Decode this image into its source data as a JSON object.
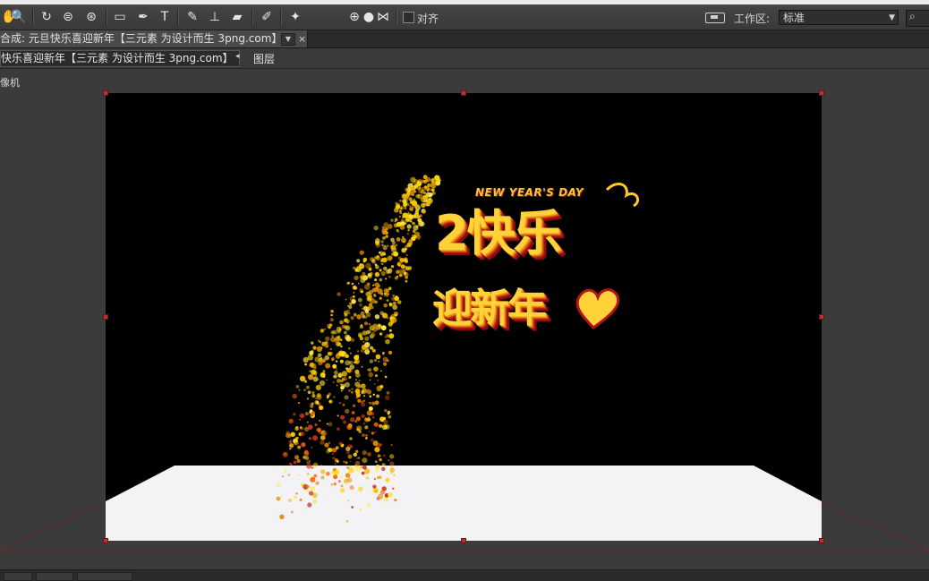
{
  "toolbar": {
    "tools": [
      {
        "icon": "hand-icon",
        "glyph": "✋"
      },
      {
        "icon": "zoom-icon",
        "glyph": "🔍"
      },
      {
        "icon": "rotate-icon",
        "glyph": "↻"
      },
      {
        "icon": "camera-orbit-icon",
        "glyph": "⊜"
      },
      {
        "icon": "pan-behind-icon",
        "glyph": "⊛"
      },
      {
        "icon": "rectangle-icon",
        "glyph": "▭"
      },
      {
        "icon": "pen-icon",
        "glyph": "✒"
      },
      {
        "icon": "text-icon",
        "glyph": "T"
      },
      {
        "icon": "brush-icon",
        "glyph": "✎"
      },
      {
        "icon": "clone-stamp-icon",
        "glyph": "⊥"
      },
      {
        "icon": "eraser-icon",
        "glyph": "▰"
      },
      {
        "icon": "roto-brush-icon",
        "glyph": "✐"
      },
      {
        "icon": "puppet-pin-icon",
        "glyph": "✦"
      },
      {
        "icon": "local-axis-icon",
        "glyph": "⊕"
      },
      {
        "icon": "world-axis-icon",
        "glyph": "●"
      },
      {
        "icon": "view-axis-icon",
        "glyph": "⋈"
      }
    ],
    "snap_label": "对齐",
    "workspace_label": "工作区:",
    "workspace_value": "标准",
    "search_glyph": "⌕"
  },
  "tab": {
    "title": "合成: 元旦快乐喜迎新年【三元素 为设计而生 3png.com】",
    "menu_glyph": "▼",
    "close_glyph": "×"
  },
  "breadcrumb": {
    "comp": "快乐喜迎新年【三元素 为设计而生 3png.com】",
    "arrow": "◂",
    "layer": "图层"
  },
  "viewer": {
    "camera_label": "像机",
    "art_subtitle": "NEW YEAR'S DAY",
    "art_line1": "2快乐",
    "art_line2": "迎新年"
  },
  "colors": {
    "handle": "#b83232",
    "particles": [
      "#ffd700",
      "#ffea4a",
      "#f5b800",
      "#e08a00",
      "#c8321e",
      "#ff6a00",
      "#fff07a"
    ]
  }
}
